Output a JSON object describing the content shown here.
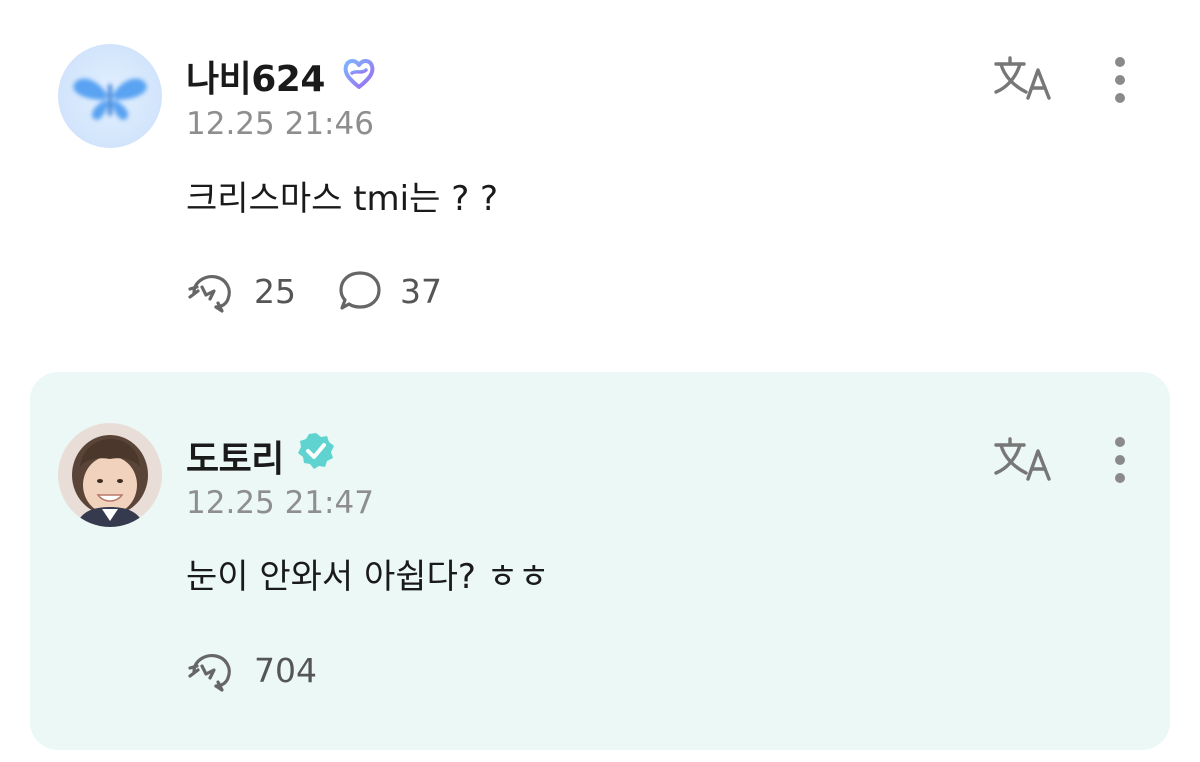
{
  "post": {
    "author": "나비624",
    "timestamp": "12.25 21:46",
    "text": "크리스마스 tmi는 ? ?",
    "reactions": {
      "cheer_count": "25",
      "comment_count": "37"
    },
    "badge_icon": "artist-heart-badge-icon",
    "avatar_icon": "butterfly-avatar"
  },
  "reply": {
    "author": "도토리",
    "timestamp": "12.25 21:47",
    "text": "눈이 안와서 아쉽다? ㅎㅎ",
    "reactions": {
      "cheer_count": "704"
    },
    "badge_icon": "verified-badge-icon",
    "background": "#ebf8f6",
    "accent": "#5fd3cf"
  },
  "icons": {
    "translate": "translate-icon",
    "more": "more-vertical-icon",
    "cheer": "cheer-icon",
    "comment": "comment-icon"
  }
}
